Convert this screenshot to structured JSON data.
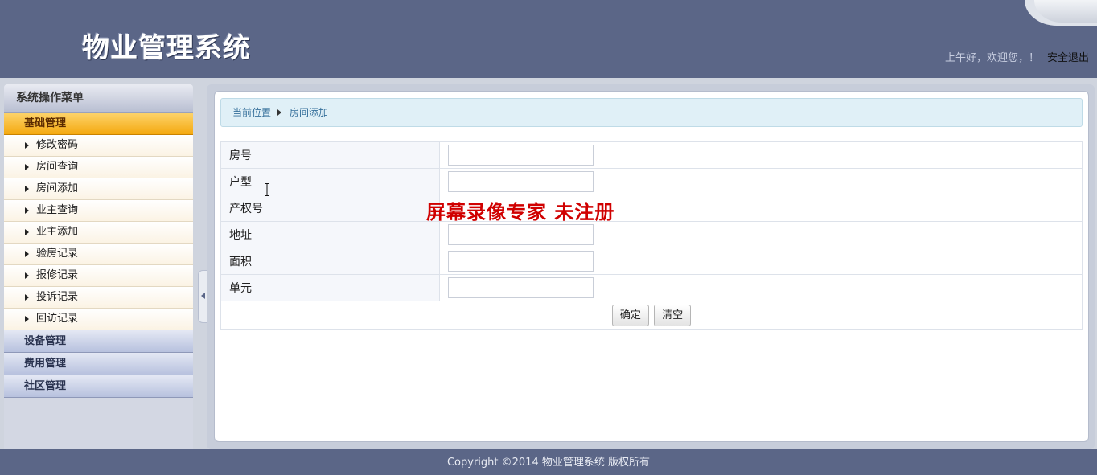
{
  "header": {
    "logo": "物业管理系统",
    "greeting": "上午好，欢迎您，！",
    "logout": "安全退出"
  },
  "sidebar": {
    "title": "系统操作菜单",
    "groups": [
      {
        "label": "基础管理",
        "active": true,
        "items": [
          {
            "label": "修改密码"
          },
          {
            "label": "房间查询"
          },
          {
            "label": "房间添加"
          },
          {
            "label": "业主查询"
          },
          {
            "label": "业主添加"
          },
          {
            "label": "验房记录"
          },
          {
            "label": "报修记录"
          },
          {
            "label": "投诉记录"
          },
          {
            "label": "回访记录"
          }
        ]
      },
      {
        "label": "设备管理"
      },
      {
        "label": "费用管理"
      },
      {
        "label": "社区管理"
      }
    ]
  },
  "breadcrumb": {
    "current": "当前位置",
    "page": "房间添加"
  },
  "form": {
    "fields": [
      {
        "label": "房号",
        "value": ""
      },
      {
        "label": "户型",
        "value": ""
      },
      {
        "label": "产权号",
        "value": ""
      },
      {
        "label": "地址",
        "value": ""
      },
      {
        "label": "面积",
        "value": ""
      },
      {
        "label": "单元",
        "value": ""
      }
    ],
    "submit": "确定",
    "reset": "清空"
  },
  "watermark": "屏幕录像专家  未注册",
  "footer": "Copyright ©2014 物业管理系统 版权所有",
  "colors": {
    "header": "#5b6687",
    "active_menu": "#f4a910",
    "watermark": "#d00000"
  }
}
